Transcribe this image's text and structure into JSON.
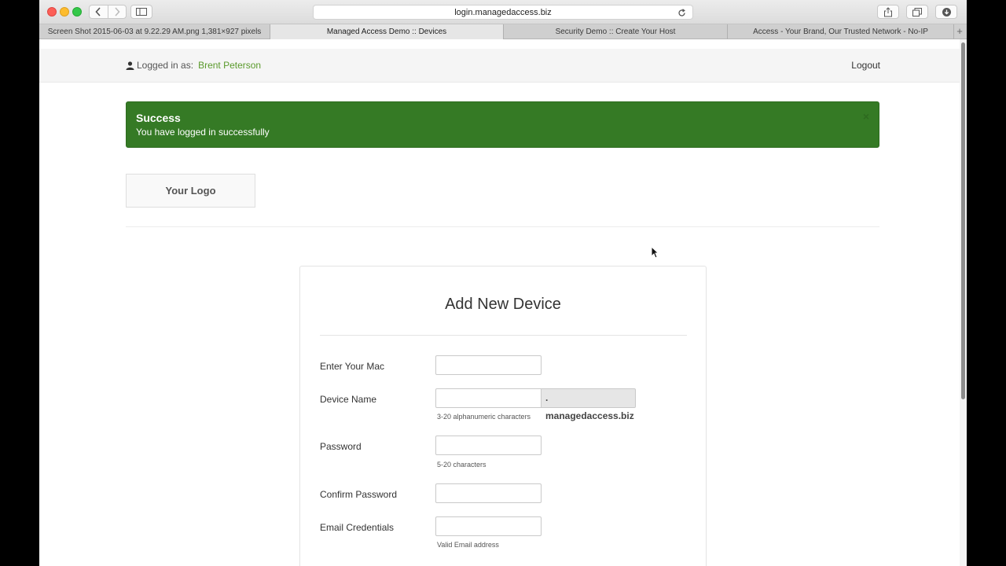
{
  "browser": {
    "url": "login.managedaccess.biz",
    "tabs": [
      {
        "label": "Screen Shot 2015-06-03 at 9.22.29 AM.png 1,381×927 pixels",
        "active": false
      },
      {
        "label": "Managed Access Demo :: Devices",
        "active": true
      },
      {
        "label": "Security Demo :: Create Your Host",
        "active": false
      },
      {
        "label": "Access - Your Brand, Our Trusted Network - No-IP",
        "active": false
      }
    ],
    "new_tab_symbol": "+"
  },
  "userbar": {
    "logged_in_prefix": "Logged in as:",
    "user_name": "Brent Peterson",
    "logout_label": "Logout"
  },
  "alert": {
    "title": "Success",
    "message": "You have logged in successfully",
    "close_symbol": "×",
    "color": "#357a25"
  },
  "logo": {
    "text": "Your Logo"
  },
  "form": {
    "title": "Add New Device",
    "fields": [
      {
        "label": "Enter Your Mac",
        "value": "",
        "help": ""
      },
      {
        "label": "Device Name",
        "value": "",
        "help": "3-20 alphanumeric characters",
        "suffix": ". managedaccess.biz"
      },
      {
        "label": "Password",
        "value": "",
        "help": "5-20 characters"
      },
      {
        "label": "Confirm Password",
        "value": "",
        "help": ""
      },
      {
        "label": "Email Credentials",
        "value": "",
        "help": "Valid Email address"
      }
    ]
  },
  "icons": [
    "back-icon",
    "forward-icon",
    "sidebar-icon",
    "reload-icon",
    "share-icon",
    "tabs-icon",
    "download-icon",
    "user-icon",
    "mouse-cursor-icon"
  ]
}
